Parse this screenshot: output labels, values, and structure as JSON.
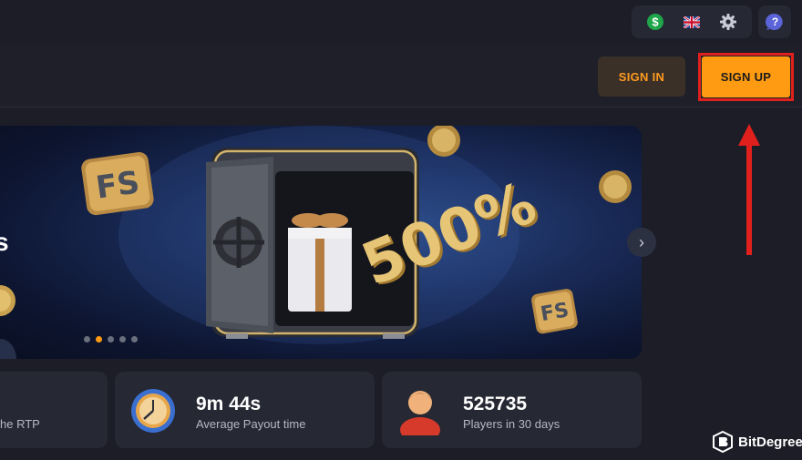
{
  "topbar": {
    "icons": [
      "dollar-icon",
      "uk-flag-icon",
      "gear-icon",
      "help-icon"
    ],
    "currency_symbol": "$",
    "help_symbol": "?"
  },
  "header": {
    "signin_label": "SIGN IN",
    "signup_label": "SIGN UP"
  },
  "banner": {
    "partial_text": "s",
    "promo_text": "500%",
    "badge_text": "FS",
    "next_symbol": "›",
    "slides_total": 5,
    "active_slide": 2
  },
  "stats": [
    {
      "value": "",
      "label": "he RTP"
    },
    {
      "value": "9m 44s",
      "label": "Average Payout time"
    },
    {
      "value": "525735",
      "label": "Players in 30 days"
    }
  ],
  "brand": {
    "name": "BitDegree"
  },
  "colors": {
    "accent": "#ff9b12",
    "background": "#1c1d27",
    "card": "#262833",
    "highlight": "#e0201c"
  }
}
